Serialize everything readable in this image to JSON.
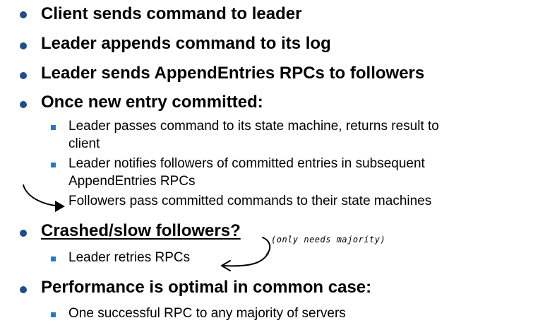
{
  "bullets": {
    "b1": "Client sends command to leader",
    "b2": "Leader appends command to its log",
    "b3": "Leader sends AppendEntries RPCs to followers",
    "b4": "Once new entry committed:",
    "b4_sub1_l1": "Leader passes command to its state machine, returns result to",
    "b4_sub1_l2": "client",
    "b4_sub2_l1": "Leader notifies followers of committed entries in subsequent",
    "b4_sub2_l2": "AppendEntries RPCs",
    "b4_sub3": "Followers pass committed commands to their state machines",
    "b5": "Crashed/slow followers?",
    "b5_sub1": "Leader retries RPCs",
    "b6": "Performance is optimal in common case:",
    "b6_sub1": "One successful RPC to any majority of servers"
  },
  "annotations": {
    "handwritten_note": "(only needs majority)"
  },
  "colors": {
    "main_bullet": "#1f4e8c",
    "sub_bullet": "#2e75c0",
    "text": "#000000"
  }
}
